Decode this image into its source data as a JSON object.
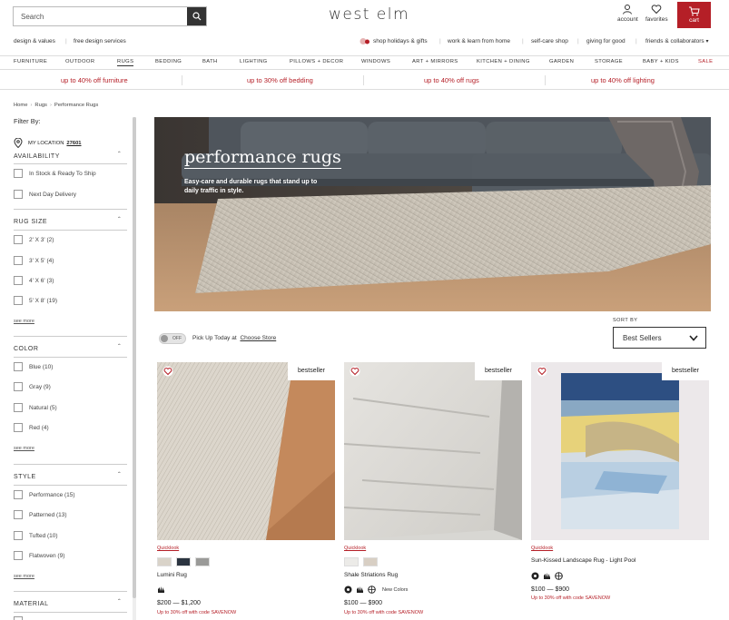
{
  "header": {
    "search_placeholder": "Search",
    "logo": "west elm",
    "account_label": "account",
    "favorites_label": "favorites",
    "cart_label": "cart"
  },
  "subnav": {
    "left": [
      "design & values",
      "free design services"
    ],
    "right": [
      "shop holidays & gifts",
      "work & learn from home",
      "self-care shop",
      "giving for good",
      "friends & collaborators"
    ]
  },
  "mainnav": [
    "FURNITURE",
    "OUTDOOR",
    "RUGS",
    "BEDDING",
    "BATH",
    "LIGHTING",
    "PILLOWS + DECOR",
    "WINDOWS",
    "ART + MIRRORS",
    "KITCHEN + DINING",
    "GARDEN",
    "STORAGE",
    "BABY + KIDS",
    "SALE"
  ],
  "promos": [
    "up to 40% off furniture",
    "up to 30% off bedding",
    "up to 40% off rugs",
    "up to 40% off lighting"
  ],
  "breadcrumb": [
    "Home",
    "Rugs",
    "Performance Rugs"
  ],
  "sidebar": {
    "filter_by": "Filter By:",
    "my_location_label": "MY LOCATION",
    "zip": "27601",
    "sections": {
      "availability": {
        "title": "AVAILABILITY",
        "items": [
          "In Stock & Ready To Ship",
          "Next Day Delivery"
        ]
      },
      "rug_size": {
        "title": "RUG SIZE",
        "items": [
          "2' X 3' (2)",
          "3' X 5' (4)",
          "4' X 6' (3)",
          "5' X 8' (19)"
        ],
        "see_more": "see more"
      },
      "color": {
        "title": "COLOR",
        "items": [
          "Blue (10)",
          "Gray (9)",
          "Natural (5)",
          "Red (4)"
        ],
        "see_more": "see more"
      },
      "style": {
        "title": "STYLE",
        "items": [
          "Performance (15)",
          "Patterned (13)",
          "Tufted (10)",
          "Flatwoven (9)"
        ],
        "see_more": "see more"
      },
      "material": {
        "title": "MATERIAL"
      }
    }
  },
  "hero": {
    "title": "performance rugs",
    "subtitle": "Easy-care and durable rugs that stand up to daily traffic in style."
  },
  "toolbar": {
    "toggle_label": "OFF",
    "pickup_text": "Pick Up Today at",
    "choose_store": "Choose Store",
    "sort_label": "SORT BY",
    "sort_value": "Best Sellers"
  },
  "products": [
    {
      "badge": "bestseller",
      "quicklook": "Quicklook",
      "name": "Lumini Rug",
      "price": "$200 — $1,200",
      "promo": "Up to 30% off with code SAVENOW",
      "swatches": [
        "#d9d3c9",
        "#2b3440",
        "#9a9a98"
      ],
      "new_colors": ""
    },
    {
      "badge": "bestseller",
      "quicklook": "Quicklook",
      "name": "Shale Striations Rug",
      "price": "$100 — $900",
      "promo": "Up to 30% off with code SAVENOW",
      "swatches": [
        "#ecebe8",
        "#d8cfc4"
      ],
      "new_colors": "New Colors"
    },
    {
      "badge": "bestseller",
      "quicklook": "Quicklook",
      "name": "Sun-Kissed Landscape Rug - Light Pool",
      "price": "$100 — $900",
      "promo": "Up to 30% off with code SAVENOW",
      "swatches": [],
      "new_colors": ""
    }
  ],
  "colors": {
    "accent": "#b51f27",
    "text": "#222222"
  }
}
